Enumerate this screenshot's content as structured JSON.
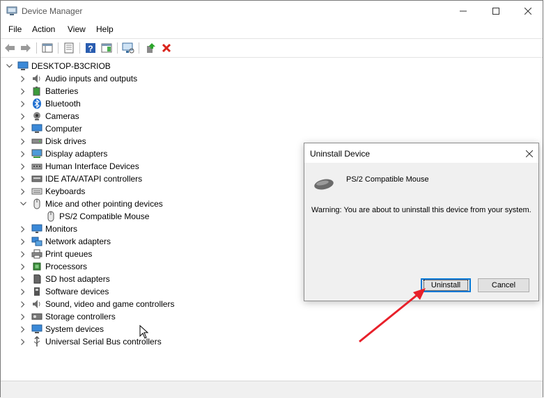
{
  "window": {
    "title": "Device Manager"
  },
  "menu": {
    "file": "File",
    "action": "Action",
    "view": "View",
    "help": "Help"
  },
  "tree": {
    "root": "DESKTOP-B3CRIOB",
    "items": [
      {
        "label": "Audio inputs and outputs",
        "icon": "speaker-icon"
      },
      {
        "label": "Batteries",
        "icon": "battery-icon"
      },
      {
        "label": "Bluetooth",
        "icon": "bluetooth-icon"
      },
      {
        "label": "Cameras",
        "icon": "camera-icon"
      },
      {
        "label": "Computer",
        "icon": "computer-icon"
      },
      {
        "label": "Disk drives",
        "icon": "disk-drive-icon"
      },
      {
        "label": "Display adapters",
        "icon": "display-adapter-icon"
      },
      {
        "label": "Human Interface Devices",
        "icon": "hid-icon"
      },
      {
        "label": "IDE ATA/ATAPI controllers",
        "icon": "ide-controller-icon"
      },
      {
        "label": "Keyboards",
        "icon": "keyboard-icon"
      },
      {
        "label": "Mice and other pointing devices",
        "icon": "mouse-icon",
        "expanded": true
      },
      {
        "label": "PS/2 Compatible Mouse",
        "icon": "mouse-icon",
        "child": true
      },
      {
        "label": "Monitors",
        "icon": "monitor-icon"
      },
      {
        "label": "Network adapters",
        "icon": "network-adapter-icon"
      },
      {
        "label": "Print queues",
        "icon": "printer-icon"
      },
      {
        "label": "Processors",
        "icon": "processor-icon"
      },
      {
        "label": "SD host adapters",
        "icon": "sd-card-icon"
      },
      {
        "label": "Software devices",
        "icon": "software-device-icon"
      },
      {
        "label": "Sound, video and game controllers",
        "icon": "speaker-icon"
      },
      {
        "label": "Storage controllers",
        "icon": "storage-controller-icon"
      },
      {
        "label": "System devices",
        "icon": "system-device-icon"
      },
      {
        "label": "Universal Serial Bus controllers",
        "icon": "usb-icon"
      }
    ]
  },
  "dialog": {
    "title": "Uninstall Device",
    "device_name": "PS/2 Compatible Mouse",
    "warning": "Warning: You are about to uninstall this device from your system.",
    "uninstall_label": "Uninstall",
    "cancel_label": "Cancel"
  },
  "colors": {
    "accent": "#0078d7",
    "annotation_arrow": "#e8202a",
    "delete_icon": "#d9241c"
  }
}
